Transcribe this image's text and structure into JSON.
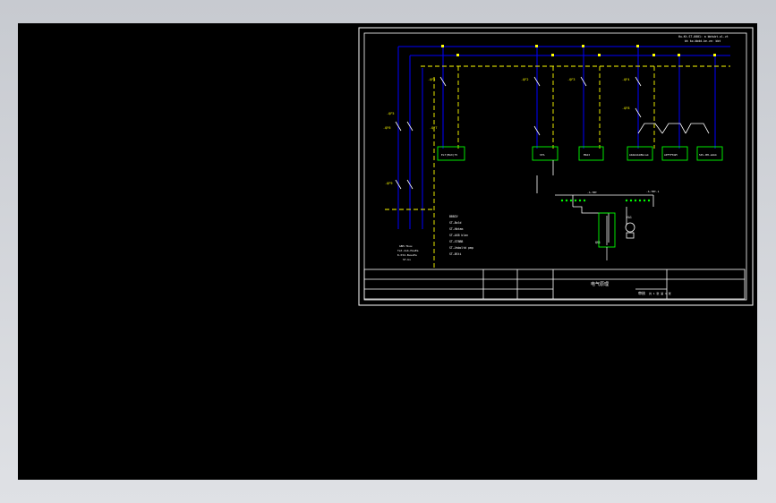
{
  "title_notes": [
    "Hu-Kt-ST-0001: a bbtubt-ul-vt",
    "bh ko-bbdd-ke-ve: bbt"
  ],
  "left_note": [
    "GBH-Tbuu",
    "Tat-dub-HuaEa",
    "K-Ktd-BuuuEa",
    "ST-bu"
  ],
  "legend": {
    "items": [
      "BBBZV",
      "ST—Bold",
      "ST—Hbtam",
      "ST—ASB blan",
      "ST—STBBB",
      "ST—Vaboltd pmp",
      "ST—BSti"
    ]
  },
  "breaker_labels": [
    "-QF1",
    "-QF2",
    "-QF3",
    "-QF4",
    "-QF5",
    "-QF6",
    "-QF7",
    "-QF8",
    "-QF9"
  ],
  "load_boxes": [
    "ELT(MAX)75",
    "SFA",
    "Mbbt",
    "AbbkbbkBbcak",
    "APFTFKAM",
    "SPL-BH-abbk"
  ],
  "aux_labels": [
    "-S-TMT",
    "-S-TMT-1",
    "QS1",
    "YA1"
  ],
  "colors": {
    "background": "#000000",
    "frame": "#ffffff",
    "bus": "#0000ff",
    "bus_dashed": "#ffff00",
    "component": "#00ff00",
    "label": "#ffff00"
  },
  "title_block": {
    "drawing_name": "电气原理",
    "sheet_label": "审核",
    "sheet_number": "共 1 张 第 1 张"
  }
}
